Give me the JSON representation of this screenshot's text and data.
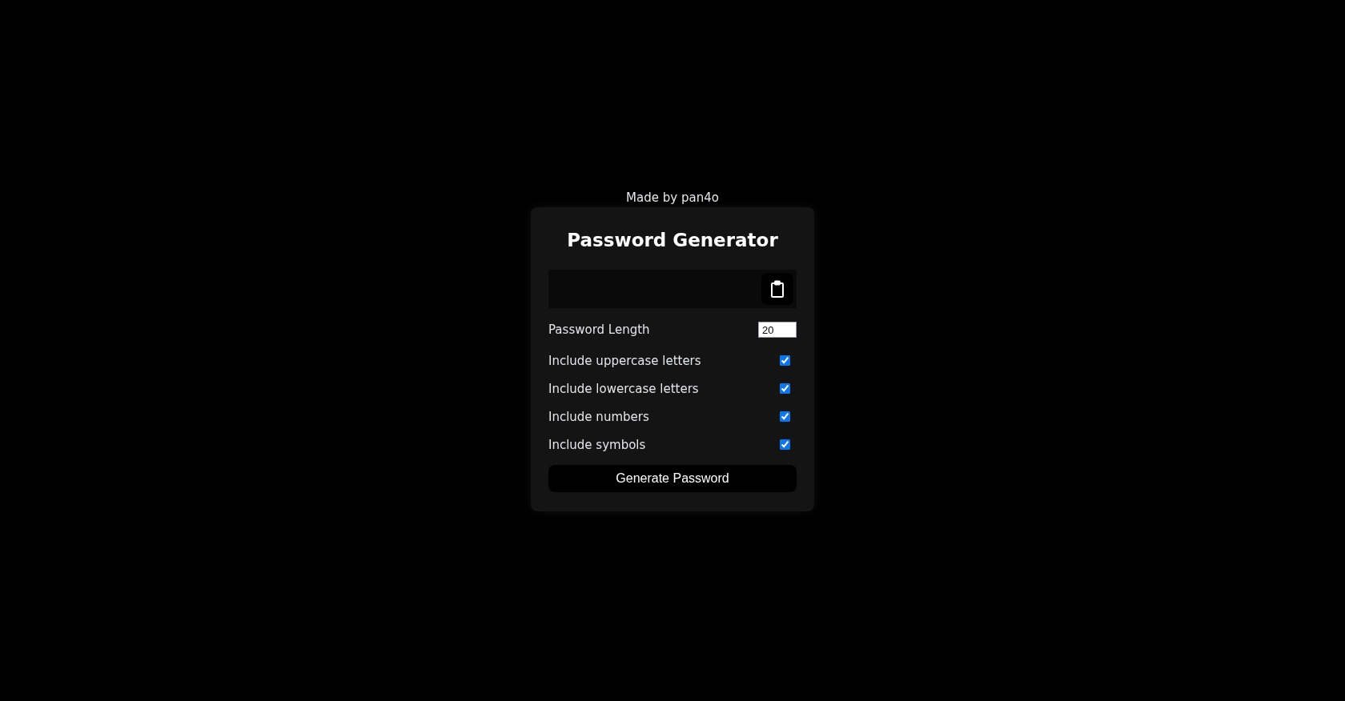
{
  "credit": "Made by pan4o",
  "title": "Password Generator",
  "length": {
    "label": "Password Length",
    "value": "20"
  },
  "options": [
    {
      "label": "Include uppercase letters",
      "checked": true
    },
    {
      "label": "Include lowercase letters",
      "checked": true
    },
    {
      "label": "Include numbers",
      "checked": true
    },
    {
      "label": "Include symbols",
      "checked": true
    }
  ],
  "button": "Generate Password"
}
